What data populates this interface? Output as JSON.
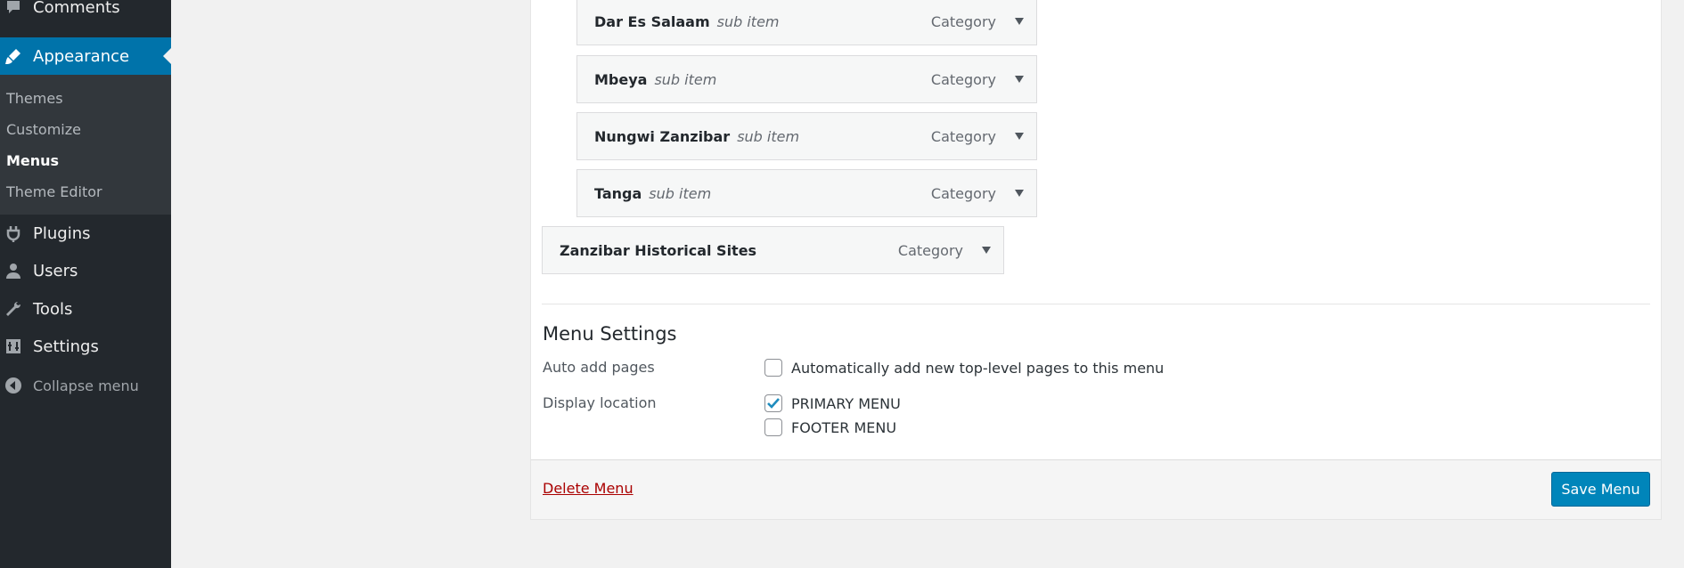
{
  "sidebar": {
    "comments": "Comments",
    "appearance": "Appearance",
    "submenu": [
      "Themes",
      "Customize",
      "Menus",
      "Theme Editor"
    ],
    "plugins": "Plugins",
    "users": "Users",
    "tools": "Tools",
    "settings": "Settings",
    "collapse": "Collapse menu"
  },
  "menu_items": [
    {
      "title": "Dar Es Salaam",
      "sub": "sub item",
      "type": "Category"
    },
    {
      "title": "Mbeya",
      "sub": "sub item",
      "type": "Category"
    },
    {
      "title": "Nungwi Zanzibar",
      "sub": "sub item",
      "type": "Category"
    },
    {
      "title": "Tanga",
      "sub": "sub item",
      "type": "Category"
    },
    {
      "title": "Zanzibar Historical Sites",
      "type": "Category"
    }
  ],
  "menu_settings": {
    "title": "Menu Settings",
    "auto_add_label": "Auto add pages",
    "auto_add_option": "Automatically add new top-level pages to this menu",
    "display_location_label": "Display location",
    "primary_menu": "PRIMARY MENU",
    "footer_menu": "FOOTER MENU"
  },
  "footer": {
    "delete": "Delete Menu",
    "save": "Save Menu"
  },
  "colors": {
    "sidebar_bg": "#23282d",
    "accent": "#0073aa",
    "primary_button": "#0085ba",
    "delete_link": "#aa0000"
  }
}
